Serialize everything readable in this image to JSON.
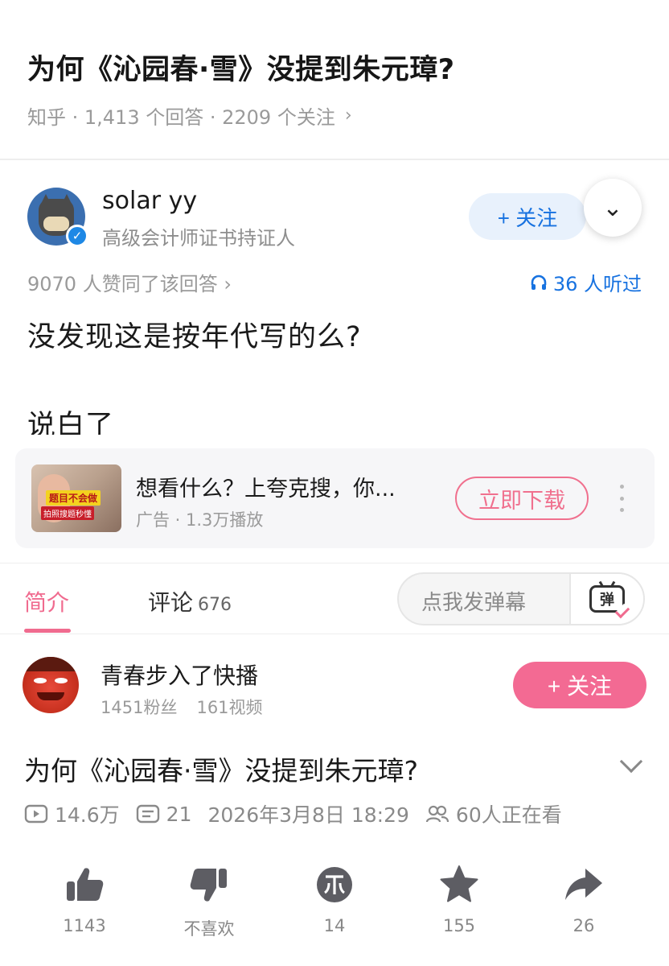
{
  "zhihu": {
    "question": "为何《沁园春·雪》没提到朱元璋?",
    "meta": "知乎 · 1,413 个回答 · 2209 个关注",
    "author_name": "solar yy",
    "author_title": "高级会计师证书持证人",
    "follow_label": "+ 关注",
    "likes_text": "9070 人赞同了该回答 ›",
    "listen_text": "36 人听过",
    "answer_line1": "没发现这是按年代写的么?",
    "answer_line2": "说白了"
  },
  "ad": {
    "thumb_tag1": "题目不会做",
    "thumb_tag2": "拍照搜题秒懂",
    "title": "想看什么？上夸克搜，你...",
    "subtitle": "广告 · 1.3万播放",
    "cta_label": "立即下载"
  },
  "tabs": {
    "intro_label": "简介",
    "comments_label": "评论",
    "comments_count": "676",
    "danmaku_placeholder": "点我发弹幕",
    "danmaku_icon_text": "弹"
  },
  "uploader": {
    "name": "青春步入了快播",
    "fans": "1451粉丝",
    "videos": "161视频",
    "follow_label": "+ 关注"
  },
  "video": {
    "title": "为何《沁园春·雪》没提到朱元璋?",
    "plays": "14.6万",
    "danmaku_count": "21",
    "date": "2026年3月8日 18:29",
    "watching": "60人正在看"
  },
  "actions": [
    {
      "icon": "thumbs-up-icon",
      "label": "1143"
    },
    {
      "icon": "thumbs-down-icon",
      "label": "不喜欢"
    },
    {
      "icon": "coin-icon",
      "label": "14"
    },
    {
      "icon": "star-icon",
      "label": "155"
    },
    {
      "icon": "share-icon",
      "label": "26"
    }
  ],
  "colors": {
    "zhihu_blue": "#1772e0",
    "bili_pink": "#f36a93",
    "muted_gray": "#9a9a9a"
  }
}
